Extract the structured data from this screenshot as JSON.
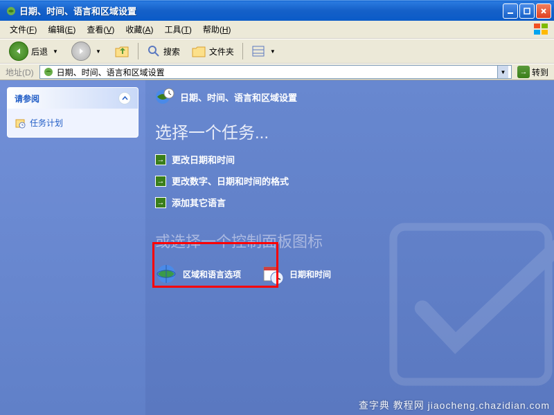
{
  "titlebar": {
    "title": "日期、时间、语言和区域设置"
  },
  "menubar": {
    "items": [
      {
        "label": "文件",
        "hk": "F"
      },
      {
        "label": "编辑",
        "hk": "E"
      },
      {
        "label": "查看",
        "hk": "V"
      },
      {
        "label": "收藏",
        "hk": "A"
      },
      {
        "label": "工具",
        "hk": "T"
      },
      {
        "label": "帮助",
        "hk": "H"
      }
    ]
  },
  "toolbar": {
    "back_label": "后退",
    "search_label": "搜索",
    "folders_label": "文件夹"
  },
  "addressbar": {
    "label": "地址(D)",
    "value": "日期、时间、语言和区域设置",
    "go_label": "转到"
  },
  "sidebar": {
    "header": "请参阅",
    "links": [
      {
        "label": "任务计划"
      }
    ]
  },
  "main": {
    "header": "日期、时间、语言和区域设置",
    "pick_task": "选择一个任务...",
    "tasks": [
      {
        "label": "更改日期和时间"
      },
      {
        "label": "更改数字、日期和时间的格式"
      },
      {
        "label": "添加其它语言"
      }
    ],
    "pick_icon": "或选择一个控制面板图标",
    "icons": [
      {
        "label": "区域和语言选项"
      },
      {
        "label": "日期和时间"
      }
    ]
  },
  "watermark": "查字典 教程网 jiaocheng.chazidian.com"
}
